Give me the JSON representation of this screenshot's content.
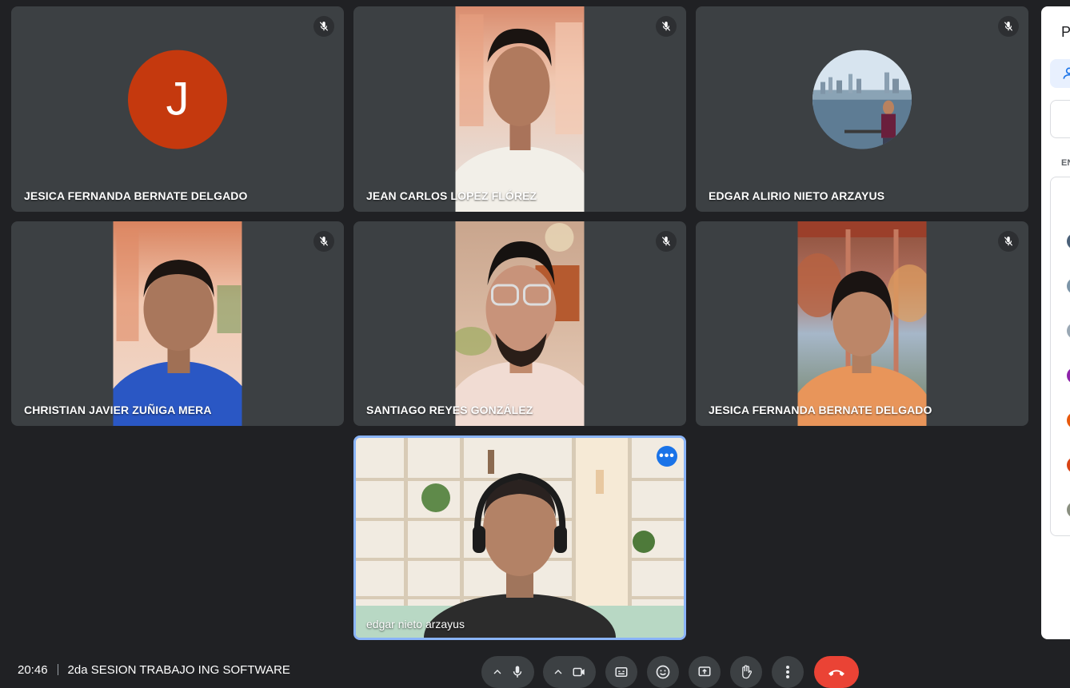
{
  "participants_grid": [
    {
      "name": "JESICA FERNANDA BERNATE DELGADO",
      "avatar_letter": "J",
      "muted": true
    },
    {
      "name": "JEAN CARLOS LOPEZ FLÓREZ",
      "muted": true
    },
    {
      "name": "EDGAR ALIRIO NIETO ARZAYUS",
      "muted": true
    },
    {
      "name": "CHRISTIAN JAVIER ZUÑIGA MERA",
      "muted": true
    },
    {
      "name": "SANTIAGO REYES GONZÁLEZ",
      "muted": true
    },
    {
      "name": "JESICA FERNANDA BERNATE DELGADO",
      "muted": true
    }
  ],
  "self_view": {
    "name": "edgar nieto arzayus"
  },
  "bottom_bar": {
    "time": "20:46",
    "meeting_title": "2da SESION TRABAJO ING SOFTWARE"
  },
  "side_panel": {
    "title_initial": "P",
    "section_initial": "EN"
  },
  "colors": {
    "background": "#202124",
    "tile": "#3c4043",
    "accent": "#8ab4f8",
    "end_call": "#ea4335",
    "avatar_j": "#c5390e"
  }
}
